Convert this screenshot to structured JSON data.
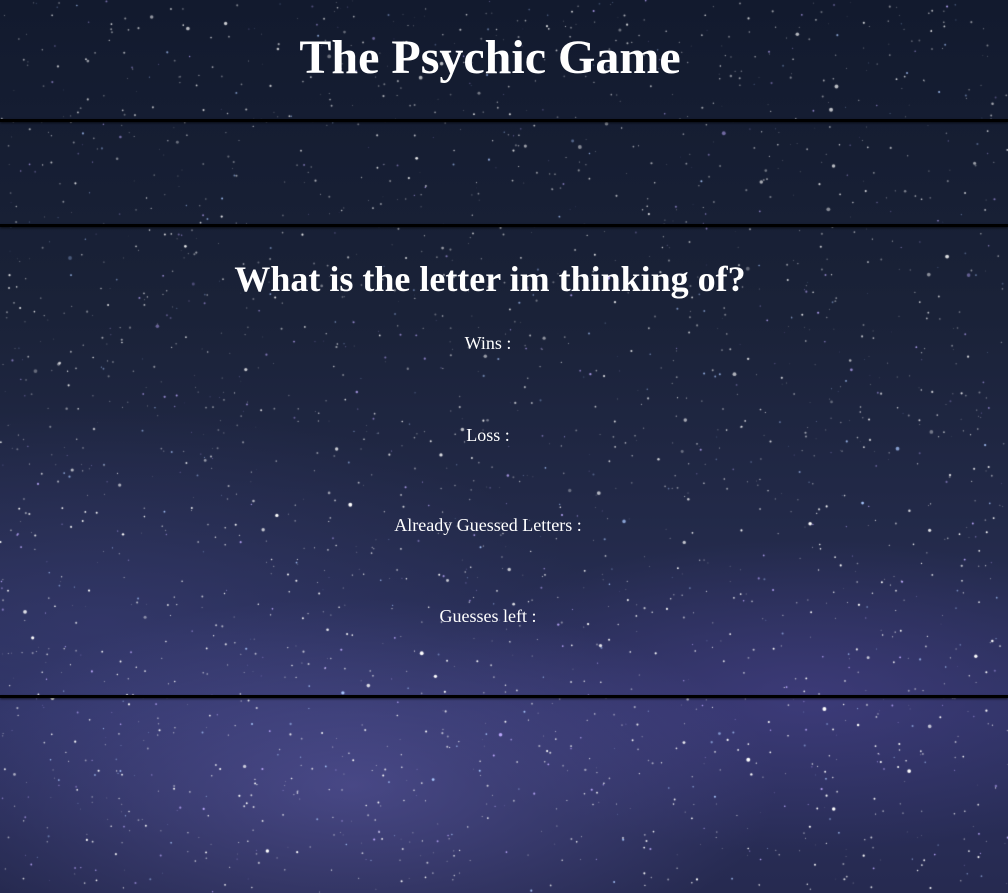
{
  "header": {
    "title": "The Psychic Game"
  },
  "game": {
    "question": "What is the letter im thinking of?",
    "stats": {
      "wins_label": "Wins :",
      "wins_value": "",
      "loss_label": "Loss :",
      "loss_value": "",
      "guessed_label": "Already Guessed Letters :",
      "guessed_value": "",
      "guesses_left_label": "Guesses left :",
      "guesses_left_value": ""
    }
  },
  "colors": {
    "text": "#ffffff",
    "divider": "#000000",
    "background_top": "#121a2e",
    "background_bottom": "#2c3160"
  },
  "background": {
    "image_name": "starry-night-milky-way-background"
  }
}
